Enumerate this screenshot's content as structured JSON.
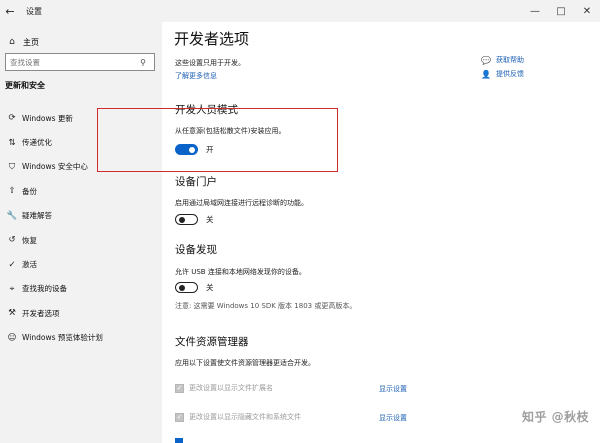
{
  "window": {
    "title": "设置",
    "back": "←",
    "minimize": "—",
    "maximize": "□",
    "close": "✕"
  },
  "sidebar": {
    "home_label": "主页",
    "search_placeholder": "查找设置",
    "section_title": "更新和安全",
    "items": [
      {
        "label": "Windows 更新",
        "icon": "refresh-icon",
        "glyph": "⟳"
      },
      {
        "label": "传递优化",
        "icon": "delivery-icon",
        "glyph": "⇅"
      },
      {
        "label": "Windows 安全中心",
        "icon": "shield-icon",
        "glyph": "⛉"
      },
      {
        "label": "备份",
        "icon": "backup-icon",
        "glyph": "⇧"
      },
      {
        "label": "疑难解答",
        "icon": "wrench-icon",
        "glyph": "🔧"
      },
      {
        "label": "恢复",
        "icon": "recovery-icon",
        "glyph": "↺"
      },
      {
        "label": "激活",
        "icon": "check-circle-icon",
        "glyph": "✓"
      },
      {
        "label": "查找我的设备",
        "icon": "find-device-icon",
        "glyph": "⌖"
      },
      {
        "label": "开发者选项",
        "icon": "developer-icon",
        "glyph": "⚒"
      },
      {
        "label": "Windows 预览体验计划",
        "icon": "insider-icon",
        "glyph": "☺"
      }
    ]
  },
  "main": {
    "title": "开发者选项",
    "intro": "这些设置只用于开发。",
    "learn_more": "了解更多信息",
    "help": [
      {
        "label": "获取帮助",
        "icon": "help-chat-icon",
        "glyph": "💬"
      },
      {
        "label": "提供反馈",
        "icon": "feedback-icon",
        "glyph": "👤"
      }
    ],
    "dev_mode": {
      "heading": "开发人员模式",
      "description": "从任意源(包括松散文件)安装应用。",
      "toggle_label": "开"
    },
    "device_portal": {
      "heading": "设备门户",
      "description": "启用通过局域网连接进行远程诊断的功能。",
      "toggle_label": "关"
    },
    "device_discovery": {
      "heading": "设备发现",
      "description": "允许 USB 连接和本地网络发现你的设备。",
      "toggle_label": "关",
      "note": "注意: 这需要 Windows 10 SDK 版本 1803 或更高版本。"
    },
    "file_explorer": {
      "heading": "文件资源管理器",
      "description": "应用以下设置使文件资源管理器更适合开发。",
      "options": [
        {
          "label": "更改设置以显示文件扩展名",
          "link": "显示设置"
        },
        {
          "label": "更改设置以显示隐藏文件和系统文件",
          "link": "显示设置"
        }
      ]
    }
  },
  "watermark": "知乎 @秋枝",
  "colors": {
    "accent": "#0a63c9",
    "link": "#1a5fb4",
    "highlight": "#d12c2c",
    "sidebar_bg": "#f2f2f2"
  }
}
